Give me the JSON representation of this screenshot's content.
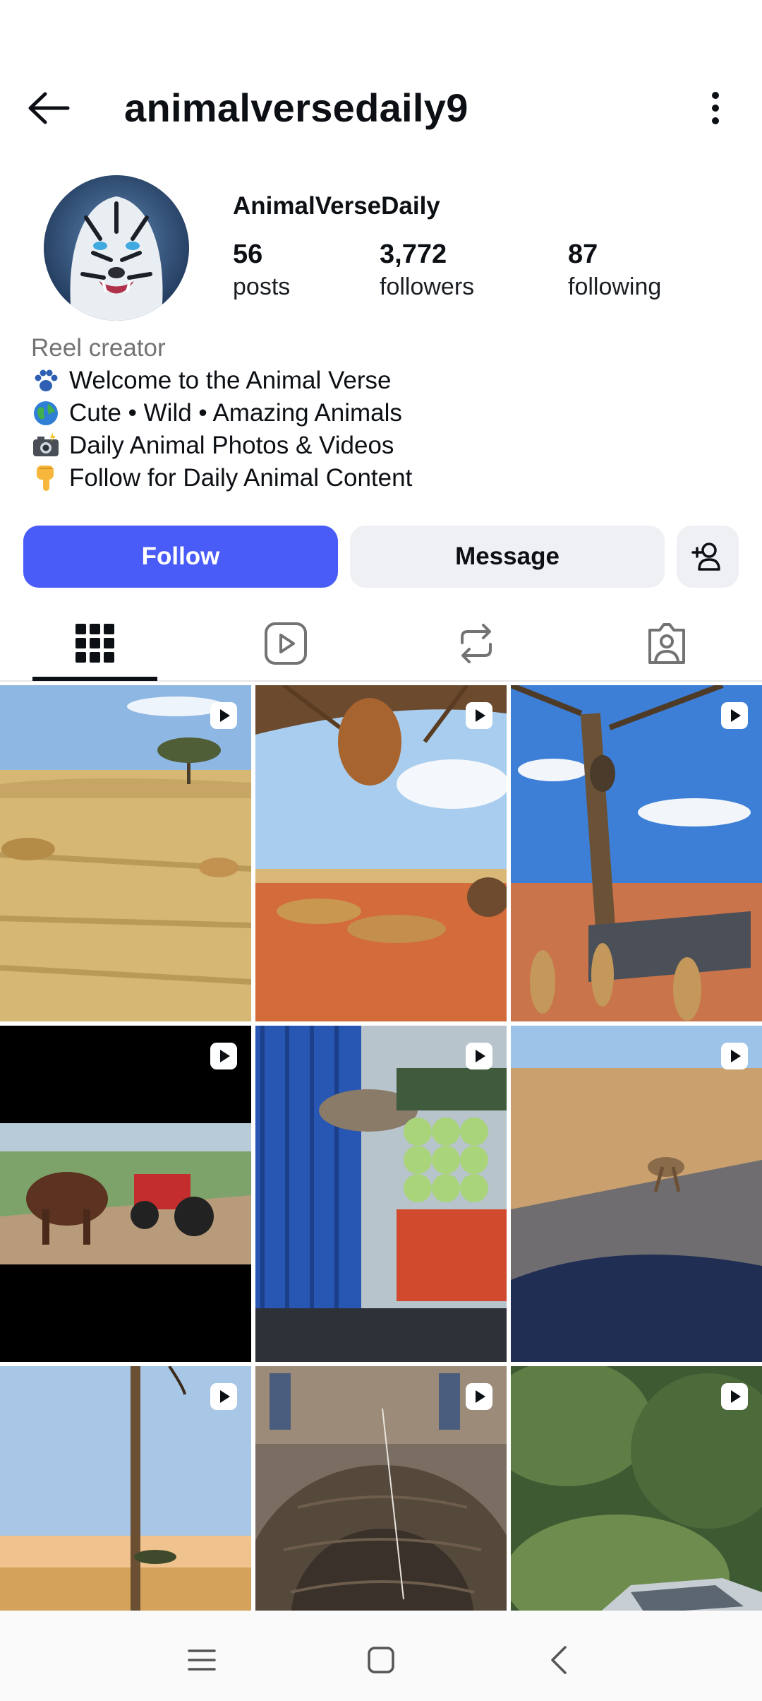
{
  "header": {
    "username": "animalversedaily9",
    "back_icon": "arrow-left-icon",
    "more_icon": "more-vertical-icon"
  },
  "profile": {
    "display_name": "AnimalVerseDaily",
    "stats": [
      {
        "value": "56",
        "label": "posts"
      },
      {
        "value": "3,772",
        "label": "followers"
      },
      {
        "value": "87",
        "label": "following"
      }
    ],
    "bio": {
      "category": "Reel creator",
      "lines": [
        {
          "emoji": "paw-icon",
          "text": "Welcome to the Animal Verse"
        },
        {
          "emoji": "globe-icon",
          "text": "Cute • Wild • Amazing Animals"
        },
        {
          "emoji": "camera-flash-icon",
          "text": "Daily Animal Photos & Videos"
        },
        {
          "emoji": "pointing-down-icon",
          "text": "Follow for Daily Animal Content"
        }
      ]
    }
  },
  "actions": {
    "follow_label": "Follow",
    "message_label": "Message",
    "add_person_icon": "add-person-icon",
    "follow_color": "#4a5cf7"
  },
  "tabs": [
    {
      "name": "grid",
      "icon": "grid-icon",
      "active": true
    },
    {
      "name": "reels",
      "icon": "reels-icon",
      "active": false
    },
    {
      "name": "reposts",
      "icon": "repost-icon",
      "active": false
    },
    {
      "name": "tagged",
      "icon": "tagged-person-icon",
      "active": false
    }
  ],
  "posts": [
    {
      "scene": "cheetah chasing in savanna grass",
      "type": "reel"
    },
    {
      "scene": "hanging beehive above resting lions",
      "type": "reel"
    },
    {
      "scene": "baboon in tree above lions and trampoline",
      "type": "reel"
    },
    {
      "scene": "bull in front of red tractor on dirt road",
      "type": "reel"
    },
    {
      "scene": "donkey in truck next to cabbage truck",
      "type": "reel"
    },
    {
      "scene": "roadrunner bird crossing road",
      "type": "reel"
    },
    {
      "scene": "tall pole over savanna at sunset",
      "type": "reel"
    },
    {
      "scene": "people looking down into stone well",
      "type": "reel"
    },
    {
      "scene": "silver car by green trees",
      "type": "reel"
    }
  ],
  "navbar": {
    "menu_icon": "menu-icon",
    "home_icon": "home-square-icon",
    "back_icon": "back-chevron-icon"
  }
}
